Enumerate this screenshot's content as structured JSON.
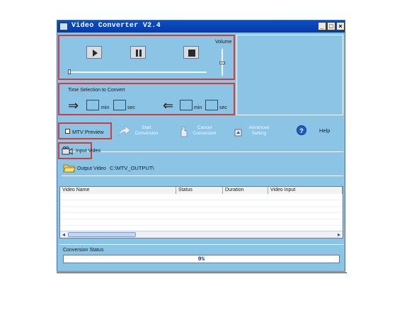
{
  "window": {
    "title": "Video Converter V2.4",
    "minimize": "_",
    "maximize": "□",
    "close": "×"
  },
  "playback": {
    "volume_label": "Volume"
  },
  "time_selection": {
    "title": "Time Selection to Convert",
    "start_min_label": "min",
    "start_sec_label": "sec",
    "end_min_label": "min",
    "end_sec_label": "sec"
  },
  "toolbar": {
    "mtv_preview": "MTV Preview",
    "start_line1": "Start",
    "start_line2": "Conversion",
    "cancel_line1": "Cancel",
    "cancel_line2": "Conversion",
    "advanced_line1": "Advanced",
    "advanced_line2": "Setting",
    "help": "Help"
  },
  "input": {
    "label": "Input Video"
  },
  "output": {
    "label": "Output Video",
    "path": "C:\\MTV_OUTPUT\\"
  },
  "table": {
    "columns": [
      "Video Name",
      "Status",
      "Duration",
      "Video Input"
    ]
  },
  "conversion": {
    "label": "Conversion Status",
    "progress": "0%",
    "progress_fraction": 0
  },
  "colors": {
    "panel": "#8cc4e6",
    "highlight": "#d23c3c",
    "title_bar": "#0a4fc4"
  }
}
